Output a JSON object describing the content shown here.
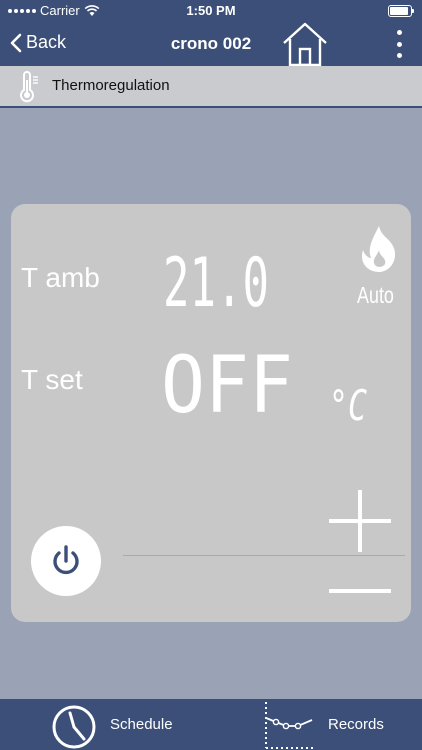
{
  "status_bar": {
    "carrier": "Carrier",
    "time": "1:50 PM"
  },
  "nav": {
    "back_label": "Back",
    "title": "crono 002"
  },
  "section": {
    "title": "Thermoregulation"
  },
  "panel": {
    "t_amb_label": "T amb",
    "t_amb_value": "21.0",
    "t_set_label": "T set",
    "t_set_value": "OFF",
    "unit": "°C",
    "mode": "Auto"
  },
  "tabs": [
    {
      "label": "Schedule",
      "icon": "clock-icon"
    },
    {
      "label": "Records",
      "icon": "chart-icon"
    }
  ],
  "colors": {
    "accent": "#3b4f78",
    "background": "#9aa2b5",
    "panel": "#c8c8c8",
    "power": "#3b4f78"
  }
}
